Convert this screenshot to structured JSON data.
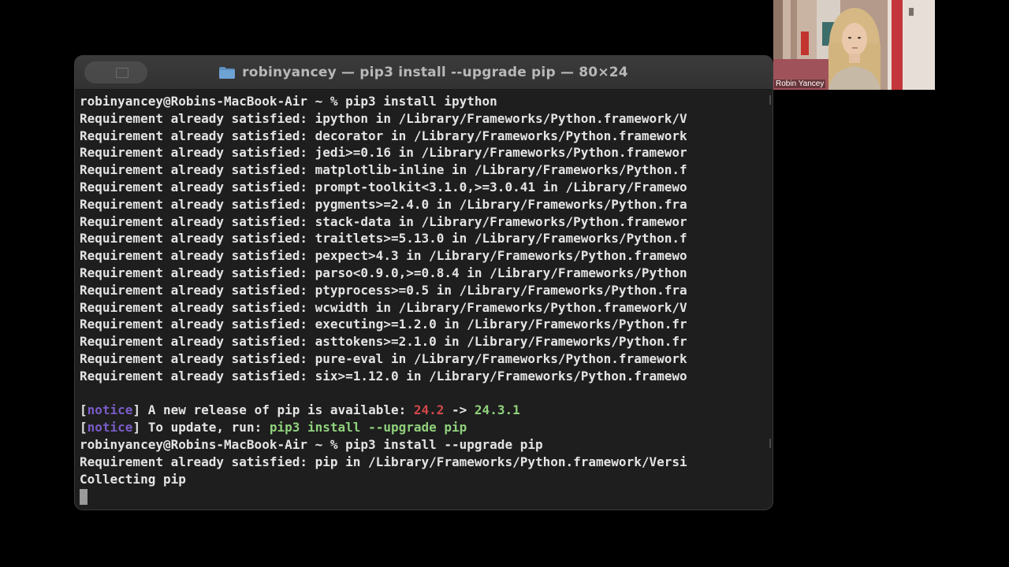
{
  "window": {
    "title": "robinyancey — pip3 install --upgrade pip — 80×24"
  },
  "terminal": {
    "prompt1": "robinyancey@Robins-MacBook-Air ~ % pip3 install ipython",
    "requirements": [
      "Requirement already satisfied: ipython in /Library/Frameworks/Python.framework/V",
      "Requirement already satisfied: decorator in /Library/Frameworks/Python.framework",
      "Requirement already satisfied: jedi>=0.16 in /Library/Frameworks/Python.framewor",
      "Requirement already satisfied: matplotlib-inline in /Library/Frameworks/Python.f",
      "Requirement already satisfied: prompt-toolkit<3.1.0,>=3.0.41 in /Library/Framewo",
      "Requirement already satisfied: pygments>=2.4.0 in /Library/Frameworks/Python.fra",
      "Requirement already satisfied: stack-data in /Library/Frameworks/Python.framewor",
      "Requirement already satisfied: traitlets>=5.13.0 in /Library/Frameworks/Python.f",
      "Requirement already satisfied: pexpect>4.3 in /Library/Frameworks/Python.framewo",
      "Requirement already satisfied: parso<0.9.0,>=0.8.4 in /Library/Frameworks/Python",
      "Requirement already satisfied: ptyprocess>=0.5 in /Library/Frameworks/Python.fra",
      "Requirement already satisfied: wcwidth in /Library/Frameworks/Python.framework/V",
      "Requirement already satisfied: executing>=1.2.0 in /Library/Frameworks/Python.fr",
      "Requirement already satisfied: asttokens>=2.1.0 in /Library/Frameworks/Python.fr",
      "Requirement already satisfied: pure-eval in /Library/Frameworks/Python.framework",
      "Requirement already satisfied: six>=1.12.0 in /Library/Frameworks/Python.framewo"
    ],
    "notice1": {
      "open": "[",
      "tag": "notice",
      "close": "]",
      "text": " A new release of pip is available: ",
      "old_version": "24.2",
      "arrow": " -> ",
      "new_version": "24.3.1"
    },
    "notice2": {
      "open": "[",
      "tag": "notice",
      "close": "]",
      "text": " To update, run: ",
      "command": "pip3 install --upgrade pip"
    },
    "prompt2": "robinyancey@Robins-MacBook-Air ~ % pip3 install --upgrade pip",
    "pip_line": "Requirement already satisfied: pip in /Library/Frameworks/Python.framework/Versi",
    "collecting": "Collecting pip"
  },
  "webcam": {
    "name": "Robin Yancey"
  },
  "colors": {
    "notice": "#7a5cc8",
    "old_version": "#d4474a",
    "new_version": "#8fd17c"
  },
  "icons": [
    "folder-icon",
    "window-controls-icon",
    "cursor-block"
  ]
}
